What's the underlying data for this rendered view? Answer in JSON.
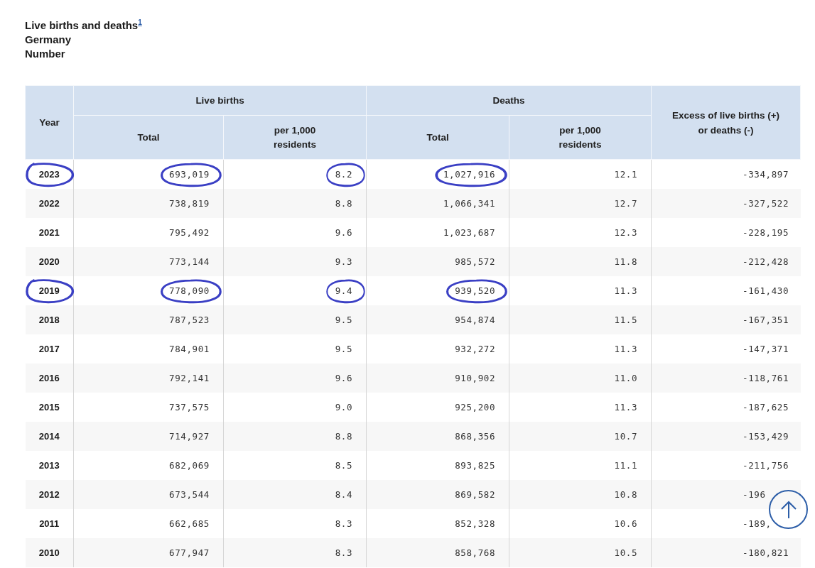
{
  "title": {
    "text": "Live births and deaths$^{1}$",
    "lines": [
      "Germany",
      "Number"
    ]
  },
  "table": {
    "year_heading": "Year",
    "groups": [
      {
        "label": "Live births",
        "columns": [
          "Total",
          "per 1,000 residents"
        ]
      },
      {
        "label": "Deaths",
        "columns": [
          "Total",
          "per 1,000 residents"
        ]
      }
    ],
    "excess_heading": "Excess of live births (+) or deaths (-)",
    "rows": [
      {
        "year": {
          "text": "2023",
          "circled": true
        },
        "cells": [
          {
            "text": "693,019",
            "circled": true
          },
          {
            "text": "8.2",
            "circled": true
          },
          {
            "text": "1,027,916",
            "circled": true
          },
          {
            "text": "12.1",
            "circled": false
          },
          {
            "text": "-334,897",
            "circled": false
          }
        ]
      },
      {
        "year": {
          "text": "2022",
          "circled": false
        },
        "cells": [
          {
            "text": "738,819",
            "circled": false
          },
          {
            "text": "8.8",
            "circled": false
          },
          {
            "text": "1,066,341",
            "circled": false
          },
          {
            "text": "12.7",
            "circled": false
          },
          {
            "text": "-327,522",
            "circled": false
          }
        ]
      },
      {
        "year": {
          "text": "2021",
          "circled": false
        },
        "cells": [
          {
            "text": "795,492",
            "circled": false
          },
          {
            "text": "9.6",
            "circled": false
          },
          {
            "text": "1,023,687",
            "circled": false
          },
          {
            "text": "12.3",
            "circled": false
          },
          {
            "text": "-228,195",
            "circled": false
          }
        ]
      },
      {
        "year": {
          "text": "2020",
          "circled": false
        },
        "cells": [
          {
            "text": "773,144",
            "circled": false
          },
          {
            "text": "9.3",
            "circled": false
          },
          {
            "text": "985,572",
            "circled": false
          },
          {
            "text": "11.8",
            "circled": false
          },
          {
            "text": "-212,428",
            "circled": false
          }
        ]
      },
      {
        "year": {
          "text": "2019",
          "circled": true
        },
        "cells": [
          {
            "text": "778,090",
            "circled": true
          },
          {
            "text": "9.4",
            "circled": true
          },
          {
            "text": "939,520",
            "circled": true
          },
          {
            "text": "11.3",
            "circled": false
          },
          {
            "text": "-161,430",
            "circled": false
          }
        ]
      },
      {
        "year": {
          "text": "2018",
          "circled": false
        },
        "cells": [
          {
            "text": "787,523",
            "circled": false
          },
          {
            "text": "9.5",
            "circled": false
          },
          {
            "text": "954,874",
            "circled": false
          },
          {
            "text": "11.5",
            "circled": false
          },
          {
            "text": "-167,351",
            "circled": false
          }
        ]
      },
      {
        "year": {
          "text": "2017",
          "circled": false
        },
        "cells": [
          {
            "text": "784,901",
            "circled": false
          },
          {
            "text": "9.5",
            "circled": false
          },
          {
            "text": "932,272",
            "circled": false
          },
          {
            "text": "11.3",
            "circled": false
          },
          {
            "text": "-147,371",
            "circled": false
          }
        ]
      },
      {
        "year": {
          "text": "2016",
          "circled": false
        },
        "cells": [
          {
            "text": "792,141",
            "circled": false
          },
          {
            "text": "9.6",
            "circled": false
          },
          {
            "text": "910,902",
            "circled": false
          },
          {
            "text": "11.0",
            "circled": false
          },
          {
            "text": "-118,761",
            "circled": false
          }
        ]
      },
      {
        "year": {
          "text": "2015",
          "circled": false
        },
        "cells": [
          {
            "text": "737,575",
            "circled": false
          },
          {
            "text": "9.0",
            "circled": false
          },
          {
            "text": "925,200",
            "circled": false
          },
          {
            "text": "11.3",
            "circled": false
          },
          {
            "text": "-187,625",
            "circled": false
          }
        ]
      },
      {
        "year": {
          "text": "2014",
          "circled": false
        },
        "cells": [
          {
            "text": "714,927",
            "circled": false
          },
          {
            "text": "8.8",
            "circled": false
          },
          {
            "text": "868,356",
            "circled": false
          },
          {
            "text": "10.7",
            "circled": false
          },
          {
            "text": "-153,429",
            "circled": false
          }
        ]
      },
      {
        "year": {
          "text": "2013",
          "circled": false
        },
        "cells": [
          {
            "text": "682,069",
            "circled": false
          },
          {
            "text": "8.5",
            "circled": false
          },
          {
            "text": "893,825",
            "circled": false
          },
          {
            "text": "11.1",
            "circled": false
          },
          {
            "text": "-211,756",
            "circled": false
          }
        ]
      },
      {
        "year": {
          "text": "2012",
          "circled": false
        },
        "cells": [
          {
            "text": "673,544",
            "circled": false
          },
          {
            "text": "8.4",
            "circled": false
          },
          {
            "text": "869,582",
            "circled": false
          },
          {
            "text": "10.8",
            "circled": false
          },
          {
            "text": "-196",
            "circled": false
          }
        ]
      },
      {
        "year": {
          "text": "2011",
          "circled": false
        },
        "cells": [
          {
            "text": "662,685",
            "circled": false
          },
          {
            "text": "8.3",
            "circled": false
          },
          {
            "text": "852,328",
            "circled": false
          },
          {
            "text": "10.6",
            "circled": false
          },
          {
            "text": "-189,",
            "circled": false
          }
        ]
      },
      {
        "year": {
          "text": "2010",
          "circled": false
        },
        "cells": [
          {
            "text": "677,947",
            "circled": false
          },
          {
            "text": "8.3",
            "circled": false
          },
          {
            "text": "858,768",
            "circled": false
          },
          {
            "text": "10.5",
            "circled": false
          },
          {
            "text": "-180,821",
            "circled": false
          }
        ]
      }
    ]
  }
}
